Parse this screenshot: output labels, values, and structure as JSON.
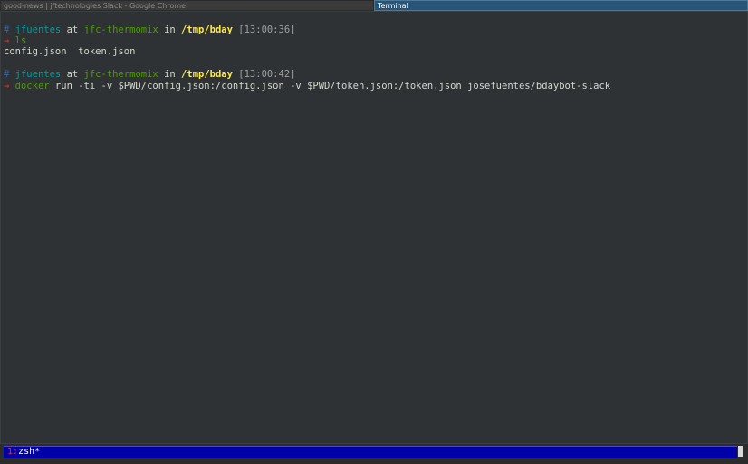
{
  "wm": {
    "tabs": [
      {
        "title": "good-news | jftechnologies Slack - Google Chrome",
        "active": false
      },
      {
        "title": "Terminal",
        "active": true
      }
    ]
  },
  "prompt1": {
    "hash": "#",
    "user": "jfuentes",
    "at": "at",
    "host": "jfc-thermomix",
    "in": "in",
    "path": "/tmp/bday",
    "time": "[13:00:36]",
    "arrow": "→",
    "command": "ls",
    "args": ""
  },
  "output1": "config.json  token.json",
  "prompt2": {
    "hash": "#",
    "user": "jfuentes",
    "at": "at",
    "host": "jfc-thermomix",
    "in": "in",
    "path": "/tmp/bday",
    "time": "[13:00:42]",
    "arrow": "→",
    "command": "docker",
    "args": "run -ti -v $PWD/config.json:/config.json -v $PWD/token.json:/token.json josefuentes/bdaybot-slack"
  },
  "status": {
    "window_index": "1:",
    "window_name": "zsh*"
  },
  "colors": {
    "terminal_bg": "#2f3234",
    "status_bg": "#0000a8",
    "active_tab_bg": "#285577"
  }
}
